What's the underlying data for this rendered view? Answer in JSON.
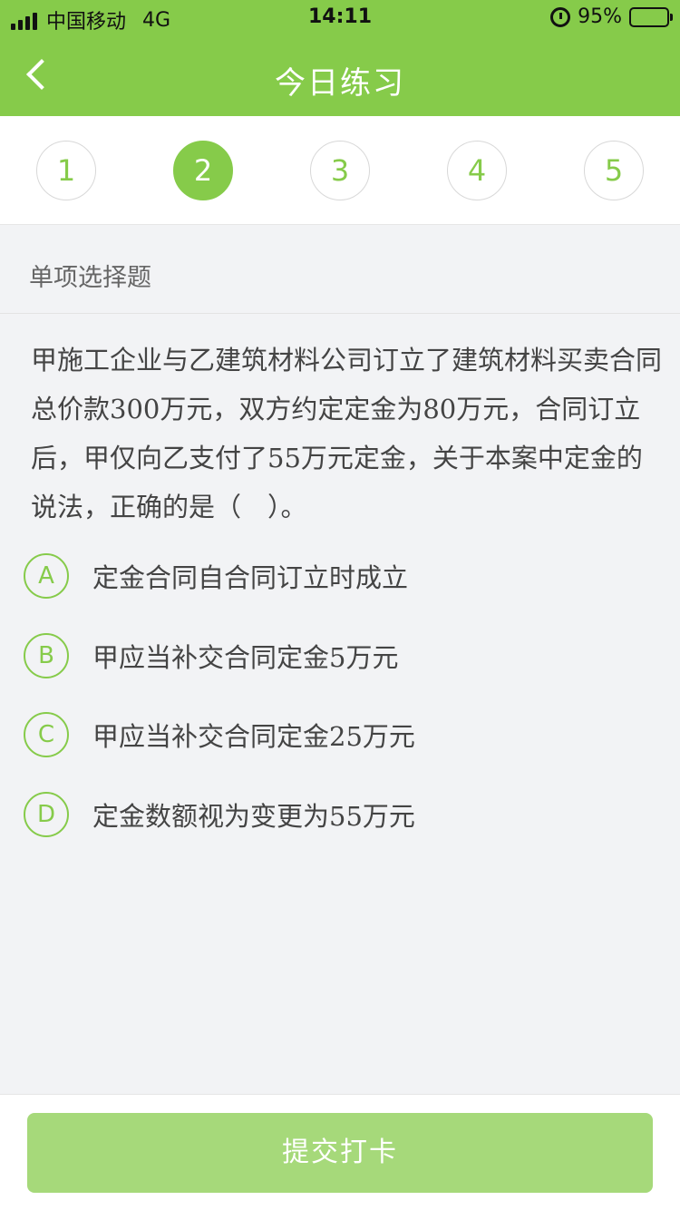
{
  "status_bar": {
    "carrier": "中国移动",
    "network": "4G",
    "time": "14:11",
    "battery": "95%",
    "battery_level": 0.95,
    "icons": [
      "signal-icon",
      "alarm-icon",
      "battery-icon"
    ]
  },
  "nav": {
    "title": "今日练习",
    "back_icon": "chevron-left-icon"
  },
  "question_numbers": [
    "1",
    "2",
    "3",
    "4",
    "5"
  ],
  "current_question": "2",
  "question_type": "单项选择题",
  "question_text": "甲施工企业与乙建筑材料公司订立了建筑材料买卖合同总价款300万元，双方约定定金为80万元，合同订立后，甲仅向乙支付了55万元定金，关于本案中定金的说法，正确的是（　）。",
  "options": [
    {
      "key": "A",
      "text": "定金合同自合同订立时成立"
    },
    {
      "key": "B",
      "text": "甲应当补交合同定金5万元"
    },
    {
      "key": "C",
      "text": "甲应当补交合同定金25万元"
    },
    {
      "key": "D",
      "text": "定金数额视为变更为55万元"
    }
  ],
  "submit_label": "提交打卡",
  "colors": {
    "accent": "#86cb4a",
    "submit_button": "#a6d97a",
    "background": "#f2f3f5"
  }
}
